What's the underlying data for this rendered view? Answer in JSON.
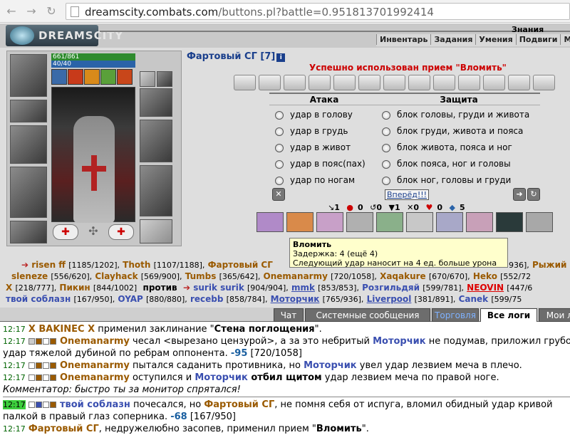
{
  "browser": {
    "url_domain": "dreamscity.combats.com",
    "url_path": "/buttons.pl?battle=0.951813701992414"
  },
  "header": {
    "logo": "DREAMSCITY",
    "knowledge": "Знания",
    "menu": [
      "Инвентарь",
      "Задания",
      "Умения",
      "Подвиги",
      "Мои"
    ]
  },
  "character": {
    "hp": "661/861",
    "hp_fraction": 0.768,
    "mana": "40/40",
    "mana_fraction": 1.0
  },
  "weapon": {
    "title": "Фартовый СГ [7]",
    "info_icon": "i"
  },
  "battle": {
    "success_message": "Успешно использован прием \"Вломить\"",
    "attack_header": "Атака",
    "defense_header": "Защита",
    "attack_options": [
      "удар в голову",
      "удар в грудь",
      "удар в живот",
      "удар в пояс(пах)",
      "удар по ногам"
    ],
    "defense_options": [
      "блок головы, груди и живота",
      "блок груди, живота и пояса",
      "блок живота, пояса и ног",
      "блок пояса, ног и головы",
      "блок ног, головы и груди"
    ],
    "forward_button": "Вперёд!!!",
    "stats": [
      "1",
      "0",
      "0",
      "1",
      "0",
      "0",
      "5"
    ]
  },
  "tooltip": {
    "title": "Вломить",
    "delay": "Задержка: 4 (ещё 4)",
    "description": "Следующий удар наносит на 4 ед. больше урона"
  },
  "roster": {
    "line1": [
      {
        "name": "risen ff",
        "hp": "[1185/1202],"
      },
      {
        "name": "Thoth",
        "hp": "[1107/1188],"
      },
      {
        "name": "Фартовый СГ",
        "hp": ""
      },
      {
        "name": "",
        "hp": "936],"
      },
      {
        "name": "Рыжий",
        "hp": ""
      }
    ],
    "line2": [
      {
        "name": "sleneze",
        "hp": "[556/620],"
      },
      {
        "name": "Clayhack",
        "hp": "[569/900],"
      },
      {
        "name": "Tumbs",
        "hp": "[365/642],"
      },
      {
        "name": "Onemanarmy",
        "hp": "[720/1058],"
      },
      {
        "name": "Xaqakure",
        "hp": "[670/670],"
      },
      {
        "name": "Heko",
        "hp": "[552/72"
      }
    ],
    "line3_left": [
      {
        "name": "X",
        "hp": "[218/777],"
      },
      {
        "name": "Пикин",
        "hp": "[844/1002]"
      }
    ],
    "versus": "против",
    "line3_right": [
      {
        "name": "surik surik",
        "hp": "[904/904],"
      },
      {
        "name": "mmk",
        "hp": "[853/853],"
      },
      {
        "name": "Розгильдяй",
        "hp": "[599/781],"
      },
      {
        "name": "NEOVIN",
        "hp": "[447/6"
      }
    ],
    "line4": [
      {
        "name": "твой соблазн",
        "hp": "[167/950],"
      },
      {
        "name": "OYAP",
        "hp": "[880/880],"
      },
      {
        "name": "recebb",
        "hp": "[858/784],"
      },
      {
        "name": "Моторчик",
        "hp": "[765/936],"
      },
      {
        "name": "Liverpool",
        "hp": "[381/891],"
      },
      {
        "name": "Canek",
        "hp": "[599/75"
      }
    ]
  },
  "tabs": [
    "Чат",
    "Системные сообщения",
    "Торговля",
    "Все логи",
    "Мои логи"
  ],
  "log": [
    {
      "time": "12:17",
      "parts": [
        "X BAKINEC X",
        " применил заклинание \"",
        "Стена поглощения",
        "\"."
      ]
    },
    {
      "time": "12:17",
      "parts": [
        "Onemanarmy",
        " чесал <вырезано цензурой>, а за это небритый ",
        "Моторчик",
        " не подумав, приложил грубо"
      ]
    },
    {
      "time": "",
      "parts": [
        "удар тяжелой дубиной по ребрам оппонента. ",
        "-95",
        " [720/1058]"
      ]
    },
    {
      "time": "12:17",
      "parts": [
        "Onemanarmy",
        " пытался саданить противника, но ",
        "Моторчик",
        " увел удар лезвием меча в плечо."
      ]
    },
    {
      "time": "12:17",
      "parts": [
        "Onemanarmy",
        " оступился и ",
        "Моторчик",
        " отбил щитом",
        " удар лезвием меча по правой ноге."
      ]
    },
    {
      "time": "",
      "parts": [
        "Комментатор: быстро ты за монитор спрятался!"
      ]
    },
    {
      "time": "12:17",
      "parts": [
        "твой соблазн",
        " почесался, но ",
        "Фартовый СГ",
        ", не помня себя от испуга, вломил обидный удар кривой"
      ]
    },
    {
      "time": "",
      "parts": [
        "палкой в правый глаз соперника. ",
        "-68",
        " [167/950]"
      ]
    },
    {
      "time": "12:17",
      "parts": [
        "Фартовый СГ",
        ", недружелюбно засопев, применил прием \"",
        "Вломить",
        "\"."
      ]
    }
  ]
}
